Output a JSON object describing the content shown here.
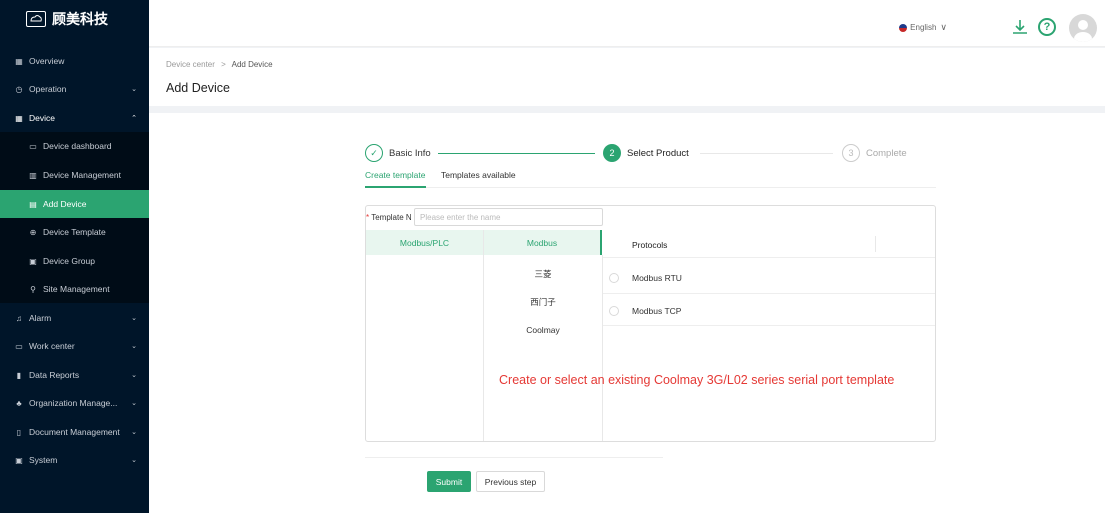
{
  "brand": {
    "name": "顾美科技",
    "logo_text": "顾美"
  },
  "sidebar": {
    "items": [
      {
        "label": "Overview",
        "icon": "overview-icon",
        "glyph": "▦"
      },
      {
        "label": "Operation",
        "icon": "operation-icon",
        "glyph": "◷",
        "arrow": "⌄"
      },
      {
        "label": "Device",
        "icon": "device-icon",
        "glyph": "▦",
        "arrow": "⌃"
      },
      {
        "label": "Device dashboard",
        "icon": "dashboard-icon",
        "glyph": "▭"
      },
      {
        "label": "Device Management",
        "icon": "management-icon",
        "glyph": "▥"
      },
      {
        "label": "Add Device",
        "icon": "add-device-icon",
        "glyph": "▤"
      },
      {
        "label": "Device Template",
        "icon": "template-icon",
        "glyph": "⊕"
      },
      {
        "label": "Device Group",
        "icon": "group-icon",
        "glyph": "▣"
      },
      {
        "label": "Site Management",
        "icon": "site-icon",
        "glyph": "⚲"
      },
      {
        "label": "Alarm",
        "icon": "alarm-icon",
        "glyph": "♫",
        "arrow": "⌄"
      },
      {
        "label": "Work center",
        "icon": "work-center-icon",
        "glyph": "▭",
        "arrow": "⌄"
      },
      {
        "label": "Data Reports",
        "icon": "data-reports-icon",
        "glyph": "▮",
        "arrow": "⌄"
      },
      {
        "label": "Organization Manage...",
        "icon": "organization-icon",
        "glyph": "♣",
        "arrow": "⌄"
      },
      {
        "label": "Document Management",
        "icon": "document-icon",
        "glyph": "▯",
        "arrow": "⌄"
      },
      {
        "label": "System",
        "icon": "system-icon",
        "glyph": "▣",
        "arrow": "⌄"
      }
    ]
  },
  "header": {
    "language": "English",
    "lang_arrow": "∨",
    "download_glyph": "⤓",
    "help_glyph": "?"
  },
  "breadcrumb": {
    "parent": "Device center",
    "separator": ">",
    "current": "Add Device"
  },
  "page_title": "Add Device",
  "steps": [
    {
      "label": "Basic Info",
      "marker": "✓",
      "state": "done"
    },
    {
      "label": "Select Product",
      "marker": "2",
      "state": "current"
    },
    {
      "label": "Complete",
      "marker": "3",
      "state": "wait"
    }
  ],
  "tabs": [
    "Create template",
    "Templates available"
  ],
  "template_name": {
    "label": "Template N",
    "required_mark": "*",
    "placeholder": "Please enter the name"
  },
  "category": {
    "header": "Modbus/PLC"
  },
  "brands_column": {
    "header": "Modbus",
    "items": [
      "三菱",
      "西门子",
      "Coolmay"
    ]
  },
  "protocols": {
    "header": "Protocols",
    "items": [
      "Modbus RTU",
      "Modbus TCP"
    ]
  },
  "note": "Create or select an existing Coolmay 3G/L02 series serial port template",
  "buttons": {
    "submit": "Submit",
    "previous": "Previous step"
  },
  "colors": {
    "accent": "#2ba471",
    "sidebar": "#001529",
    "warning_text": "#e53935"
  }
}
